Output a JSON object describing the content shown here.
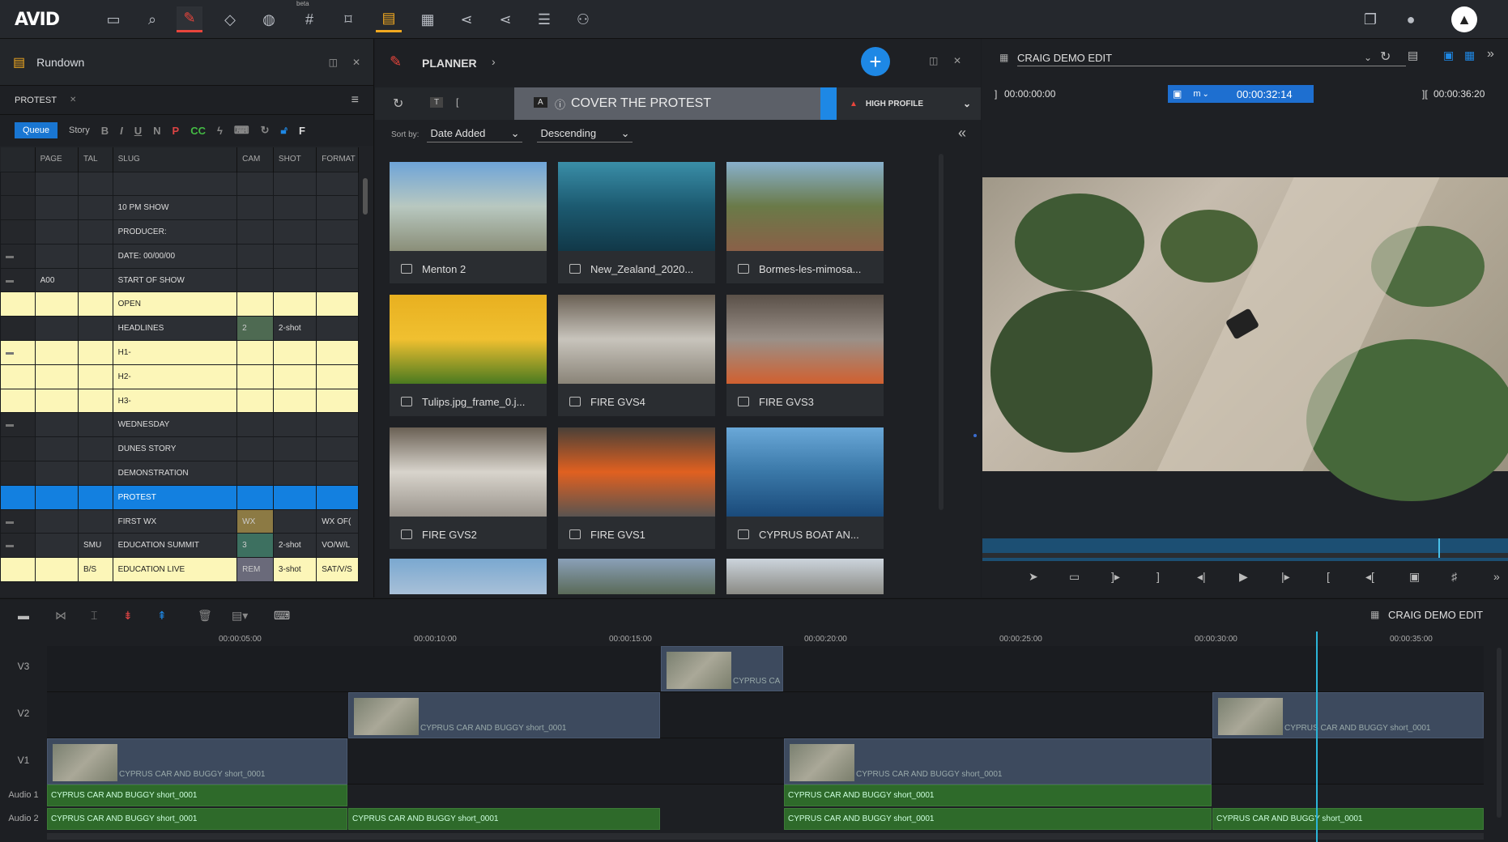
{
  "app": {
    "logo": "AVID",
    "beta": "beta"
  },
  "rundown": {
    "title": "Rundown",
    "tab": "PROTEST",
    "queue_label": "Queue",
    "story_label": "Story",
    "format_buttons": [
      "B",
      "I",
      "U",
      "N",
      "P",
      "CC"
    ],
    "cols": {
      "page": "PAGE",
      "tal": "TAL",
      "slug": "SLUG",
      "cam": "CAM",
      "shot": "SHOT",
      "format": "FORMAT"
    },
    "rows": [
      {
        "page": "",
        "tal": "",
        "slug": "",
        "cam": "",
        "shot": "",
        "format": "",
        "style": ""
      },
      {
        "page": "",
        "tal": "",
        "slug": "10 PM SHOW",
        "cam": "",
        "shot": "",
        "format": "",
        "style": ""
      },
      {
        "page": "",
        "tal": "",
        "slug": "PRODUCER:",
        "cam": "",
        "shot": "",
        "format": "",
        "style": ""
      },
      {
        "page": "",
        "tal": "",
        "slug": "DATE: 00/00/00",
        "cam": "",
        "shot": "",
        "format": "",
        "style": ""
      },
      {
        "page": "A00",
        "tal": "",
        "slug": "START OF SHOW",
        "cam": "",
        "shot": "",
        "format": "",
        "style": ""
      },
      {
        "page": "",
        "tal": "",
        "slug": "OPEN",
        "cam": "",
        "shot": "",
        "format": "",
        "style": "y"
      },
      {
        "page": "",
        "tal": "",
        "slug": "HEADLINES",
        "cam": "2",
        "shot": "2-shot",
        "format": "",
        "style": ""
      },
      {
        "page": "",
        "tal": "",
        "slug": "H1-",
        "cam": "",
        "shot": "",
        "format": "",
        "style": "y"
      },
      {
        "page": "",
        "tal": "",
        "slug": "H2-",
        "cam": "",
        "shot": "",
        "format": "",
        "style": "y"
      },
      {
        "page": "",
        "tal": "",
        "slug": "H3-",
        "cam": "",
        "shot": "",
        "format": "",
        "style": "y"
      },
      {
        "page": "",
        "tal": "",
        "slug": "WEDNESDAY",
        "cam": "",
        "shot": "",
        "format": "",
        "style": ""
      },
      {
        "page": "",
        "tal": "",
        "slug": "DUNES STORY",
        "cam": "",
        "shot": "",
        "format": "",
        "style": ""
      },
      {
        "page": "",
        "tal": "",
        "slug": "DEMONSTRATION",
        "cam": "",
        "shot": "",
        "format": "",
        "style": ""
      },
      {
        "page": "",
        "tal": "",
        "slug": "PROTEST",
        "cam": "",
        "shot": "",
        "format": "",
        "style": "sel"
      },
      {
        "page": "",
        "tal": "",
        "slug": "FIRST WX",
        "cam": "WX",
        "shot": "",
        "format": "WX OF(",
        "style": ""
      },
      {
        "page": "",
        "tal": "SMU",
        "slug": "EDUCATION SUMMIT",
        "cam": "3",
        "shot": "2-shot",
        "format": "VO/W/L",
        "style": ""
      },
      {
        "page": "",
        "tal": "B/S",
        "slug": "EDUCATION LIVE",
        "cam": "REM",
        "shot": "3-shot",
        "format": "SAT/V/S",
        "style": "y"
      }
    ]
  },
  "planner": {
    "title": "PLANNER",
    "story_title": "COVER THE PROTEST",
    "badge": "A",
    "t_label": "T",
    "priority": "HIGH PROFILE",
    "sort_by_label": "Sort by:",
    "sort_field": "Date Added",
    "sort_order": "Descending",
    "tiles": [
      {
        "label": "Menton 2",
        "colors": [
          "#6ea4d8",
          "#b8c8c0",
          "#8a8e78"
        ]
      },
      {
        "label": "New_Zealand_2020...",
        "colors": [
          "#3a8ea8",
          "#1c5a70",
          "#113848"
        ]
      },
      {
        "label": "Bormes-les-mimosa...",
        "colors": [
          "#88b0cc",
          "#6a7a48",
          "#8a6048"
        ]
      },
      {
        "label": "Tulips.jpg_frame_0.j...",
        "colors": [
          "#e8b020",
          "#f0c030",
          "#4a7a20"
        ]
      },
      {
        "label": "FIRE GVS4",
        "colors": [
          "#6a6054",
          "#c8c4bc",
          "#8a8478"
        ]
      },
      {
        "label": "FIRE GVS3",
        "colors": [
          "#5a5048",
          "#9a9088",
          "#d06030"
        ]
      },
      {
        "label": "FIRE GVS2",
        "colors": [
          "#6a6054",
          "#d8d4cc",
          "#9a948c"
        ]
      },
      {
        "label": "FIRE GVS1",
        "colors": [
          "#4a4038",
          "#e06020",
          "#5a5450"
        ]
      },
      {
        "label": "CYPRUS BOAT AN...",
        "colors": [
          "#6aa8d8",
          "#3a78a8",
          "#1a4a7a"
        ]
      }
    ]
  },
  "viewer": {
    "title": "CRAIG DEMO EDIT",
    "tc_in": "00:00:00:00",
    "tc_current": "00:00:32:14",
    "tc_mode": "m",
    "tc_out": "00:00:36:20"
  },
  "timeline": {
    "title": "CRAIG DEMO EDIT",
    "ruler": [
      "00:00:05:00",
      "00:00:10:00",
      "00:00:15:00",
      "00:00:20:00",
      "00:00:25:00",
      "00:00:30:00",
      "00:00:35:00"
    ],
    "tracks": [
      "V3",
      "V2",
      "V1",
      "Audio 1",
      "Audio 2"
    ],
    "clip_name": "CYPRUS CAR AND BUGGY short_0001",
    "clip_short": "CYPRUS CA"
  }
}
